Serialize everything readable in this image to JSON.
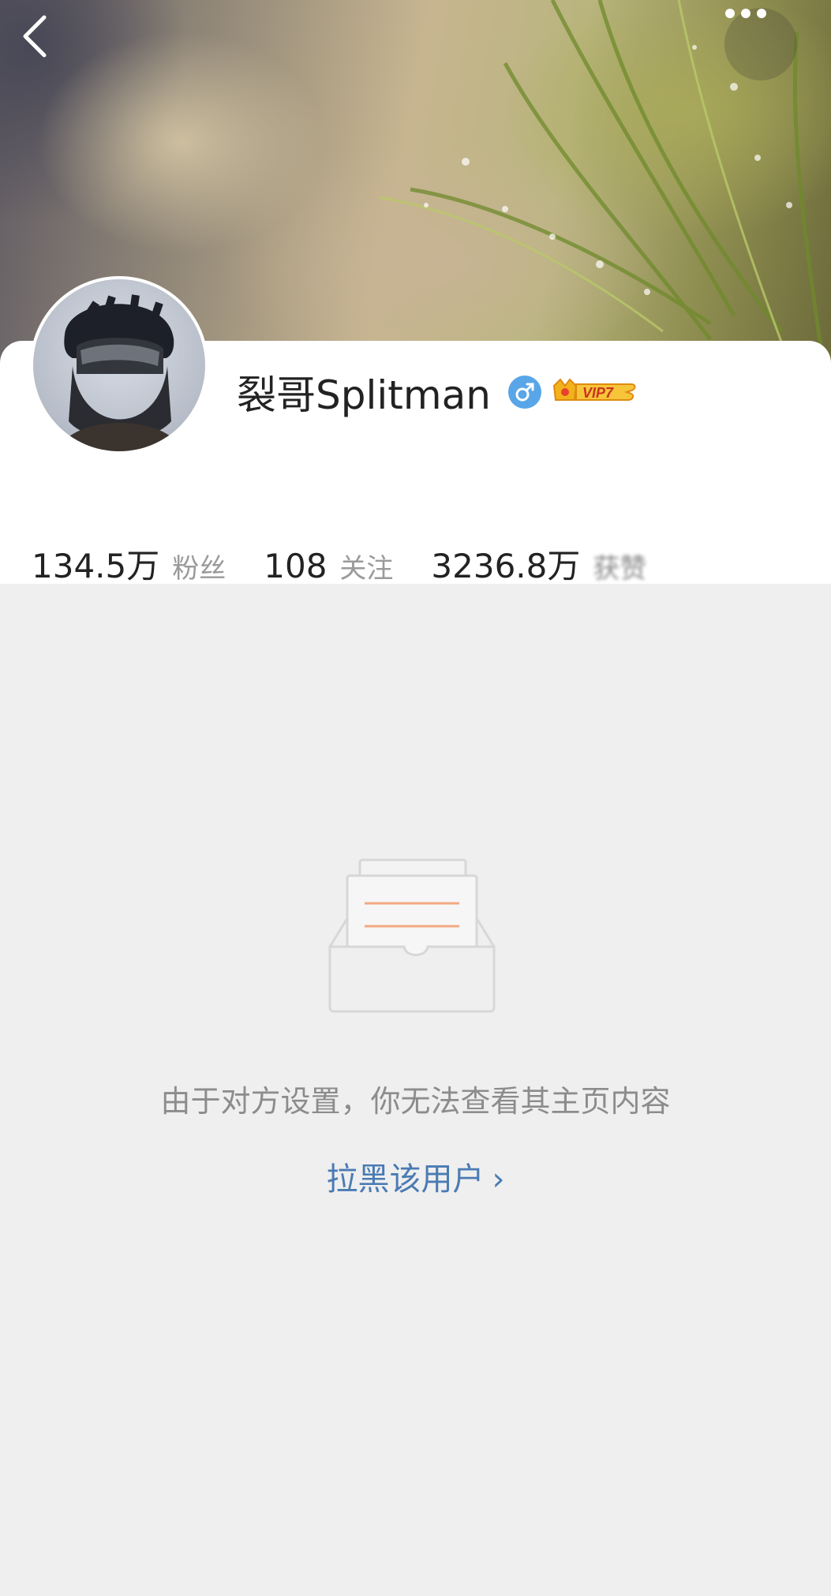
{
  "header": {
    "back_icon": "chevron-left-icon",
    "more_icon": "more-dots-icon"
  },
  "profile": {
    "name": "裂哥Splitman",
    "gender_icon": "male-icon",
    "gender_color": "#58a6e7",
    "vip_badge": "VIP7",
    "vip_color": "#f2b21c"
  },
  "stats": [
    {
      "value": "134.5万",
      "label": "粉丝"
    },
    {
      "value": "108",
      "label": "关注"
    },
    {
      "value": "3236.8万",
      "label": "获赞"
    }
  ],
  "empty_state": {
    "icon": "empty-inbox-icon",
    "message": "由于对方设置，你无法查看其主页内容",
    "link_label": "拉黑该用户",
    "link_chevron": "›",
    "link_color": "#4a7bb3"
  }
}
